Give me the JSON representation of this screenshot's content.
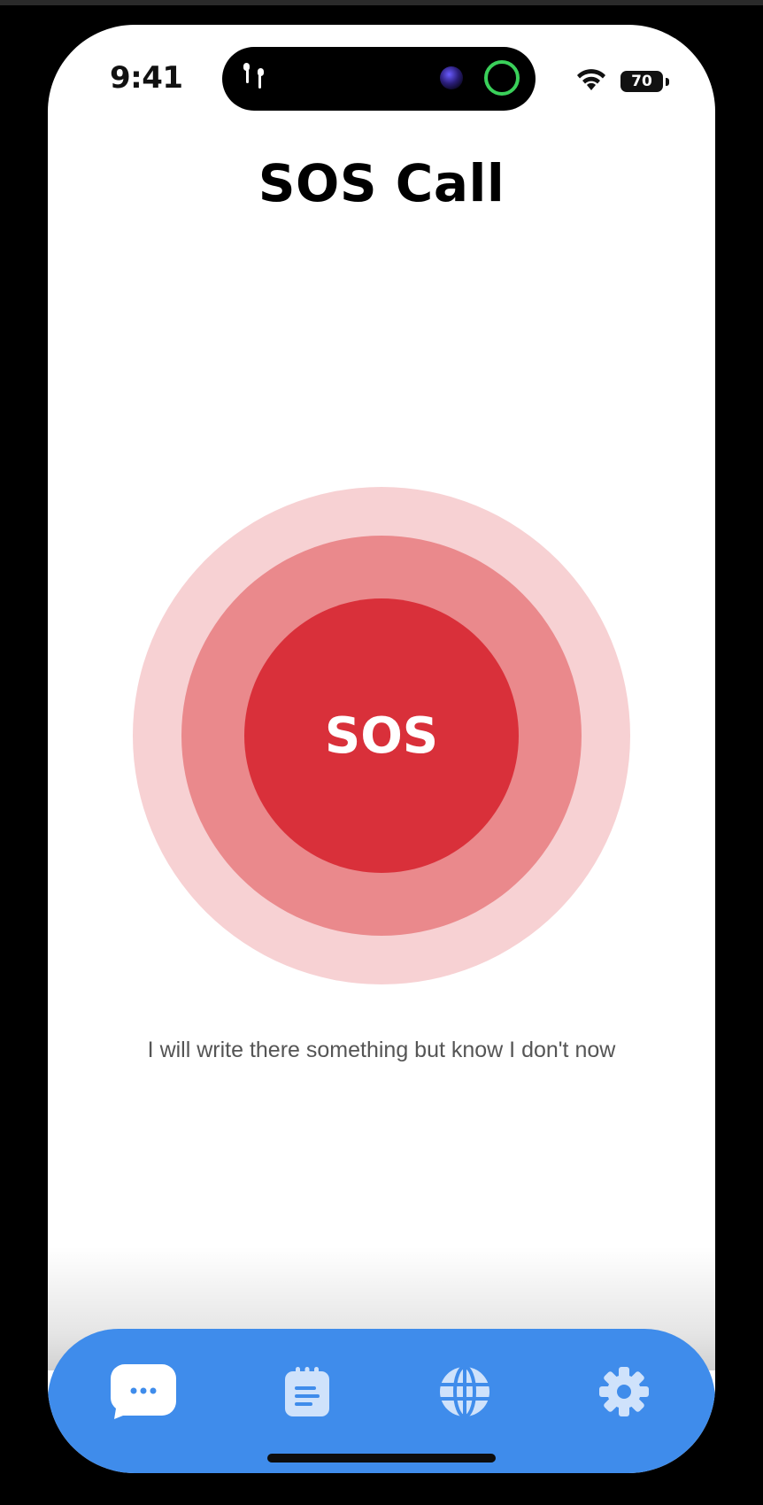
{
  "status_bar": {
    "time": "9:41",
    "battery": "70",
    "icons": [
      "airpods-icon",
      "camera-icon",
      "activity-ring-icon",
      "wifi-icon",
      "battery-icon"
    ]
  },
  "header": {
    "title": "SOS Call"
  },
  "sos": {
    "label": "SOS"
  },
  "description": "I will write there something but know I don't now",
  "tab_bar": {
    "items": [
      {
        "icon": "chat-bubble-icon",
        "active": true
      },
      {
        "icon": "notes-icon",
        "active": false
      },
      {
        "icon": "globe-icon",
        "active": false
      },
      {
        "icon": "gear-icon",
        "active": false
      }
    ]
  },
  "colors": {
    "accent_blue": "#3f8ceb",
    "sos_red": "#d9303a",
    "ring_mid": "#ea898c",
    "ring_outer": "#f7d1d3",
    "icon_light": "#cfe2fb"
  }
}
